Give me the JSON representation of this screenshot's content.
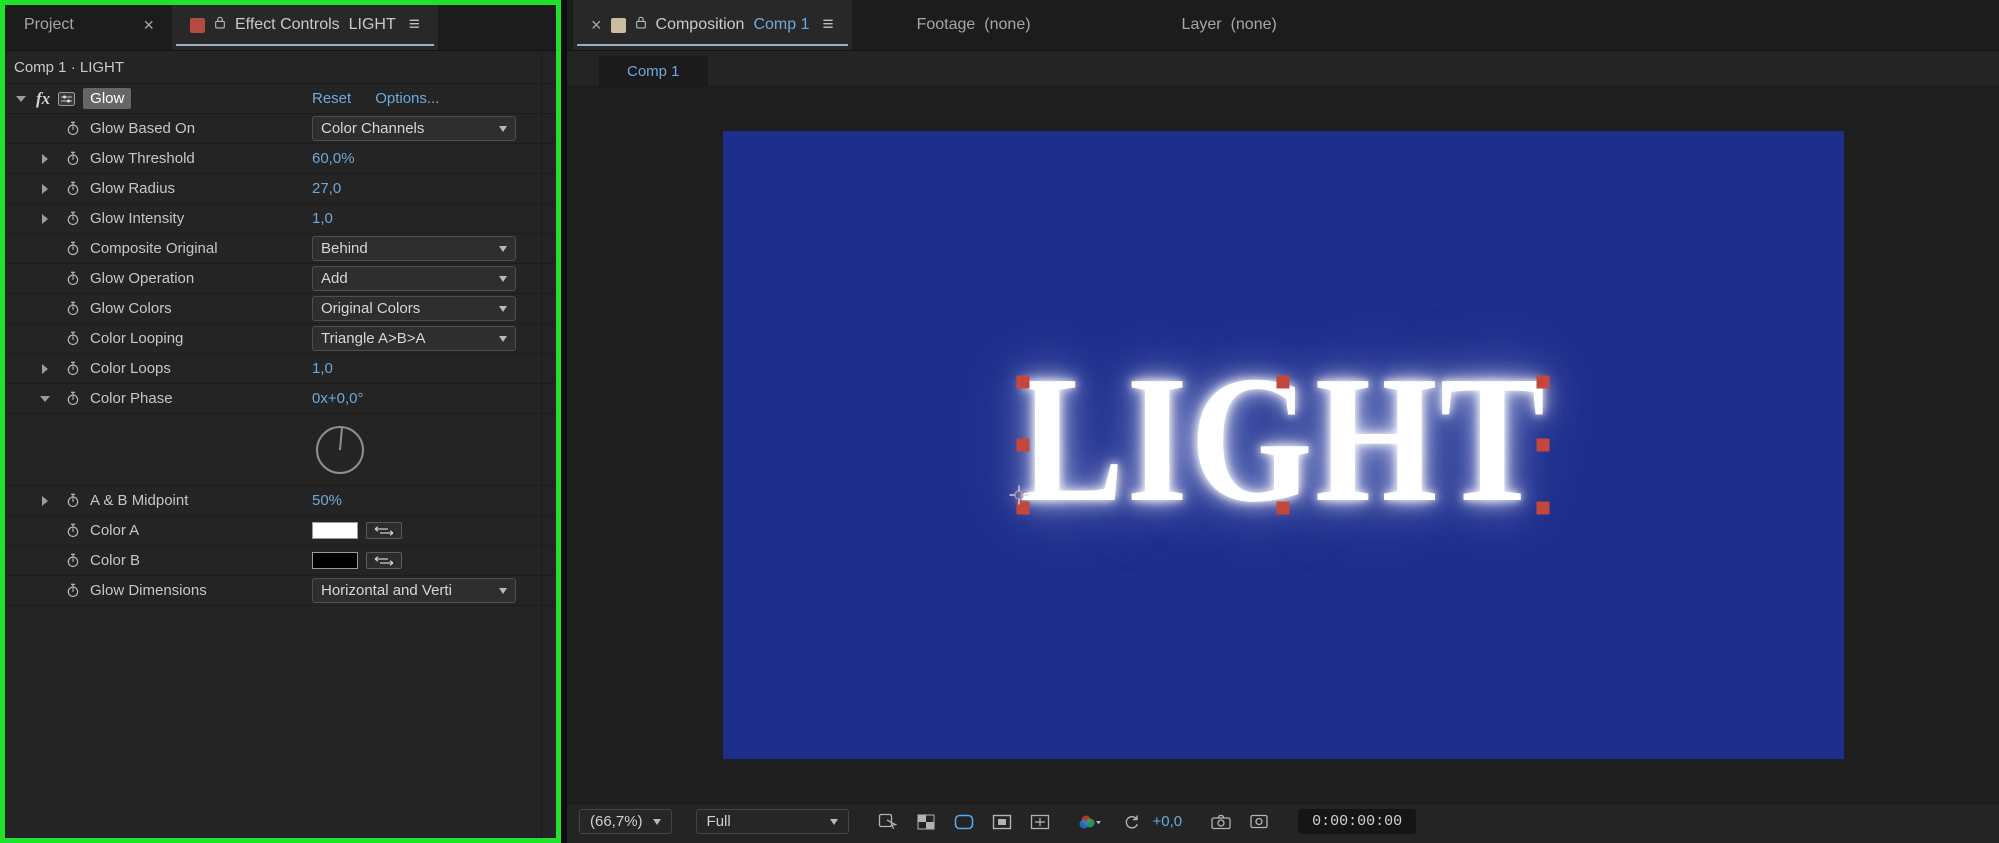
{
  "colors": {
    "accent_blue": "#6ea9dc",
    "comp_background": "#1e2e8c",
    "selection_handle": "#c4473b",
    "highlight_outline": "#21e22b",
    "left_tab_swatch": "#b54a3f",
    "right_tab_swatch": "#c9bd9e",
    "color_a_swatch": "#ffffff",
    "color_b_swatch": "#000000"
  },
  "effect_controls": {
    "tabs": {
      "project_label": "Project",
      "title": "Effect Controls",
      "comp_name": "LIGHT",
      "menu_icon": "≡",
      "close_icon": "×"
    },
    "breadcrumb": "Comp 1 · LIGHT",
    "effect": {
      "fx_badge": "fx",
      "name": "Glow",
      "reset_label": "Reset",
      "options_label": "Options..."
    },
    "params": [
      {
        "label": "Glow Based On",
        "control": "dropdown",
        "value": "Color Channels"
      },
      {
        "label": "Glow Threshold",
        "control": "value",
        "value": "60,0%"
      },
      {
        "label": "Glow Radius",
        "control": "value",
        "value": "27,0"
      },
      {
        "label": "Glow Intensity",
        "control": "value",
        "value": "1,0"
      },
      {
        "label": "Composite Original",
        "control": "dropdown",
        "value": "Behind"
      },
      {
        "label": "Glow Operation",
        "control": "dropdown",
        "value": "Add"
      },
      {
        "label": "Glow Colors",
        "control": "dropdown",
        "value": "Original Colors"
      },
      {
        "label": "Color Looping",
        "control": "dropdown",
        "value": "Triangle A>B>A"
      },
      {
        "label": "Color Loops",
        "control": "value",
        "value": "1,0"
      },
      {
        "label": "Color Phase",
        "control": "dial",
        "value": "0x+0,0°"
      },
      {
        "label": "A & B Midpoint",
        "control": "value",
        "value": "50%"
      },
      {
        "label": "Color A",
        "control": "color",
        "swatch": "#ffffff"
      },
      {
        "label": "Color B",
        "control": "color",
        "swatch": "#000000"
      },
      {
        "label": "Glow Dimensions",
        "control": "dropdown",
        "value": "Horizontal and Verti"
      }
    ]
  },
  "composition": {
    "tabs": {
      "close_icon": "×",
      "title": "Composition",
      "comp_name": "Comp 1",
      "menu_icon": "≡",
      "footage_label": "Footage",
      "footage_value": "(none)",
      "layer_label": "Layer",
      "layer_value": "(none)"
    },
    "viewer_tab": "Comp 1",
    "canvas_text": "LIGHT",
    "toolbar": {
      "zoom": "(66,7%)",
      "resolution": "Full",
      "exposure": "+0,0",
      "timecode": "0:00:00:00"
    }
  }
}
